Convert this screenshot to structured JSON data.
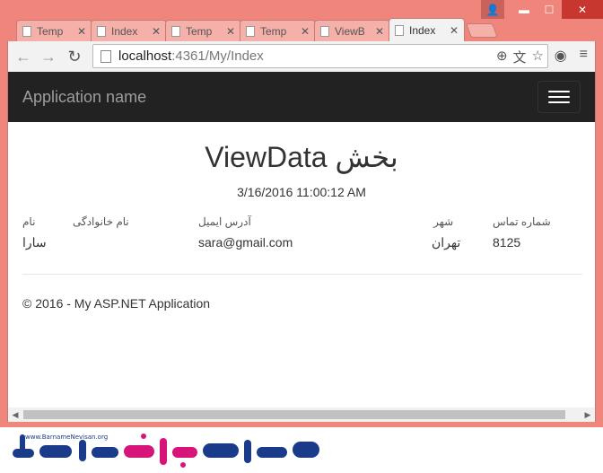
{
  "window": {
    "controls": {
      "user": "👤",
      "minimize": "▬",
      "maximize": "☐",
      "close": "✕"
    }
  },
  "tabs": [
    {
      "label": "Temp",
      "active": false
    },
    {
      "label": "Index",
      "active": false
    },
    {
      "label": "Temp",
      "active": false
    },
    {
      "label": "Temp",
      "active": false
    },
    {
      "label": "ViewB",
      "active": false
    },
    {
      "label": "Index",
      "active": true
    }
  ],
  "toolbar": {
    "back": "←",
    "forward": "→",
    "reload": "↻",
    "url_host": "localhost",
    "url_rest": ":4361/My/Index",
    "zoom_icon": "⊕",
    "translate_icon": "文",
    "star_icon": "☆",
    "extension_icon": "◉",
    "menu_icon": "≡"
  },
  "page": {
    "brand": "Application name",
    "heading": "ViewData بخش",
    "datetime": "3/16/2016 11:00:12 AM",
    "table": {
      "headers": {
        "first_name": "نام",
        "last_name": "نام خانوادگی",
        "email": "آدرس ایمیل",
        "city": "شهر",
        "phone": "شماره تماس"
      },
      "row": {
        "first_name": "سارا",
        "last_name": "",
        "email": "sara@gmail.com",
        "city": "تهران",
        "phone": "8125"
      }
    },
    "footer": "© 2016 - My ASP.NET Application"
  },
  "scrollbar": {
    "left": "◀",
    "right": "▶"
  },
  "watermark": {
    "tagline": "www.BarnameNevisan.org"
  },
  "colors": {
    "window_frame": "#f0857b",
    "navbar": "#222222",
    "brand_text": "#9d9d9d",
    "logo_blue": "#1a3a8a",
    "logo_magenta": "#d7147a"
  }
}
